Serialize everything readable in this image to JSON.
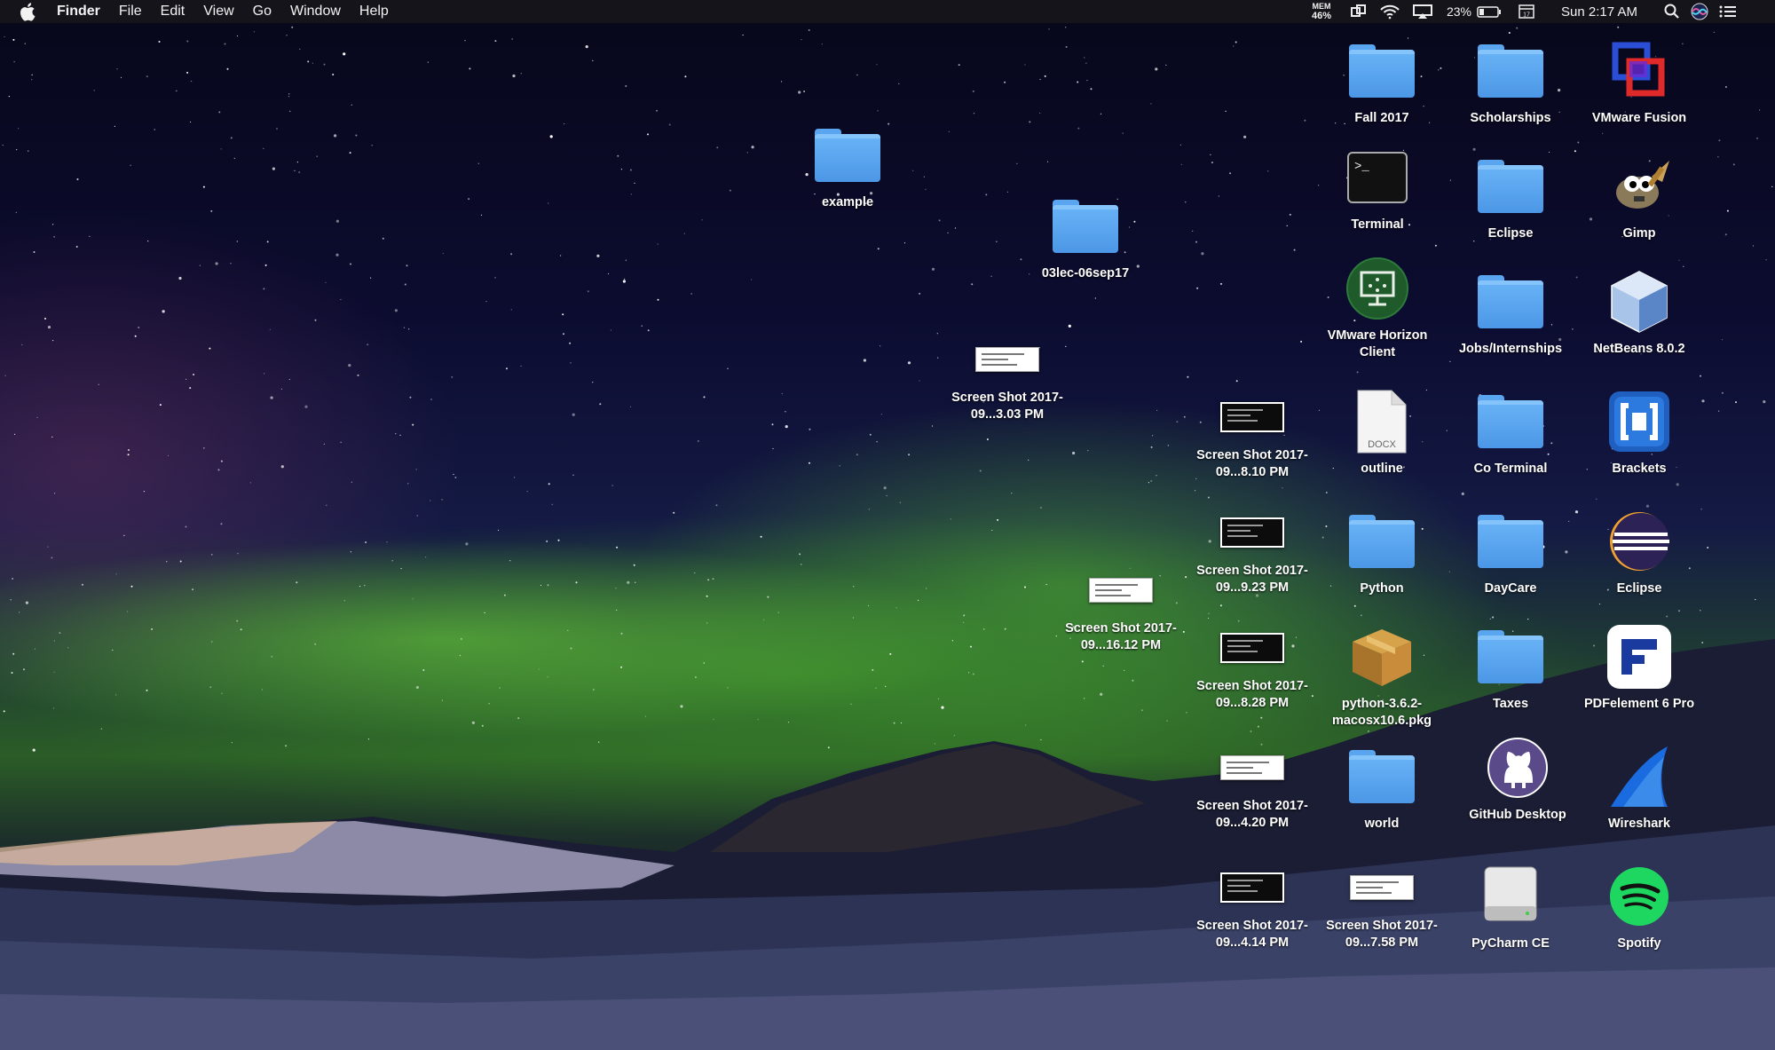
{
  "menubar": {
    "apple_icon": "apple-icon",
    "app_name": "Finder",
    "menus": [
      "File",
      "Edit",
      "View",
      "Go",
      "Window",
      "Help"
    ],
    "status": {
      "mem_label": "MEM",
      "mem_value": "46%",
      "battery_percent": "23%",
      "clock": "Sun 2:17 AM",
      "icons": [
        "mem-monitor-icon",
        "screen-mirroring-icon",
        "wifi-icon",
        "airplay-icon",
        "battery-icon",
        "calendar-icon",
        "spotlight-icon",
        "siri-icon",
        "notification-center-icon"
      ]
    }
  },
  "desktop": {
    "icons": [
      {
        "label": "Fall 2017",
        "kind": "folder"
      },
      {
        "label": "Scholarships",
        "kind": "folder"
      },
      {
        "label": "VMware Fusion",
        "kind": "app-vmware-fusion"
      },
      {
        "label": "Terminal",
        "kind": "app-terminal"
      },
      {
        "label": "Eclipse",
        "kind": "folder"
      },
      {
        "label": "Gimp",
        "kind": "app-gimp"
      },
      {
        "label": "VMware Horizon Client",
        "kind": "app-vmware-horizon"
      },
      {
        "label": "Jobs/Internships",
        "kind": "folder"
      },
      {
        "label": "NetBeans 8.0.2",
        "kind": "app-netbeans"
      },
      {
        "label": "outline",
        "kind": "docx-file",
        "badge": "DOCX"
      },
      {
        "label": "Co Terminal",
        "kind": "folder"
      },
      {
        "label": "Brackets",
        "kind": "app-brackets"
      },
      {
        "label": "Python",
        "kind": "folder"
      },
      {
        "label": "DayCare",
        "kind": "folder"
      },
      {
        "label": "Eclipse",
        "kind": "app-eclipse"
      },
      {
        "label": "python-3.6.2-macosx10.6.pkg",
        "kind": "package"
      },
      {
        "label": "Taxes",
        "kind": "folder"
      },
      {
        "label": "PDFelement 6 Pro",
        "kind": "app-pdfelement"
      },
      {
        "label": "world",
        "kind": "folder"
      },
      {
        "label": "GitHub Desktop",
        "kind": "app-github"
      },
      {
        "label": "Wireshark",
        "kind": "app-wireshark"
      },
      {
        "label": "Screen Shot 2017-09...7.58 PM",
        "kind": "screenshot-light"
      },
      {
        "label": "PyCharm CE",
        "kind": "drive"
      },
      {
        "label": "Spotify",
        "kind": "app-spotify"
      },
      {
        "label": "Screen Shot 2017-09...8.10 PM",
        "kind": "screenshot-dark"
      },
      {
        "label": "Screen Shot 2017-09...9.23 PM",
        "kind": "screenshot-dark"
      },
      {
        "label": "Screen Shot 2017-09...8.28 PM",
        "kind": "screenshot-dark"
      },
      {
        "label": "Screen Shot 2017-09...4.20 PM",
        "kind": "screenshot-light"
      },
      {
        "label": "Screen Shot 2017-09...4.14 PM",
        "kind": "screenshot-dark"
      },
      {
        "label": "example",
        "kind": "folder"
      },
      {
        "label": "03lec-06sep17",
        "kind": "folder"
      },
      {
        "label": "Screen Shot 2017-09...3.03 PM",
        "kind": "screenshot-light"
      },
      {
        "label": "Screen Shot 2017-09...16.12 PM",
        "kind": "screenshot-light"
      }
    ]
  },
  "colors": {
    "menubar_bg": "#16161a",
    "folder_blue": "#5aa5ef",
    "aurora_green": "#5fd13c"
  }
}
